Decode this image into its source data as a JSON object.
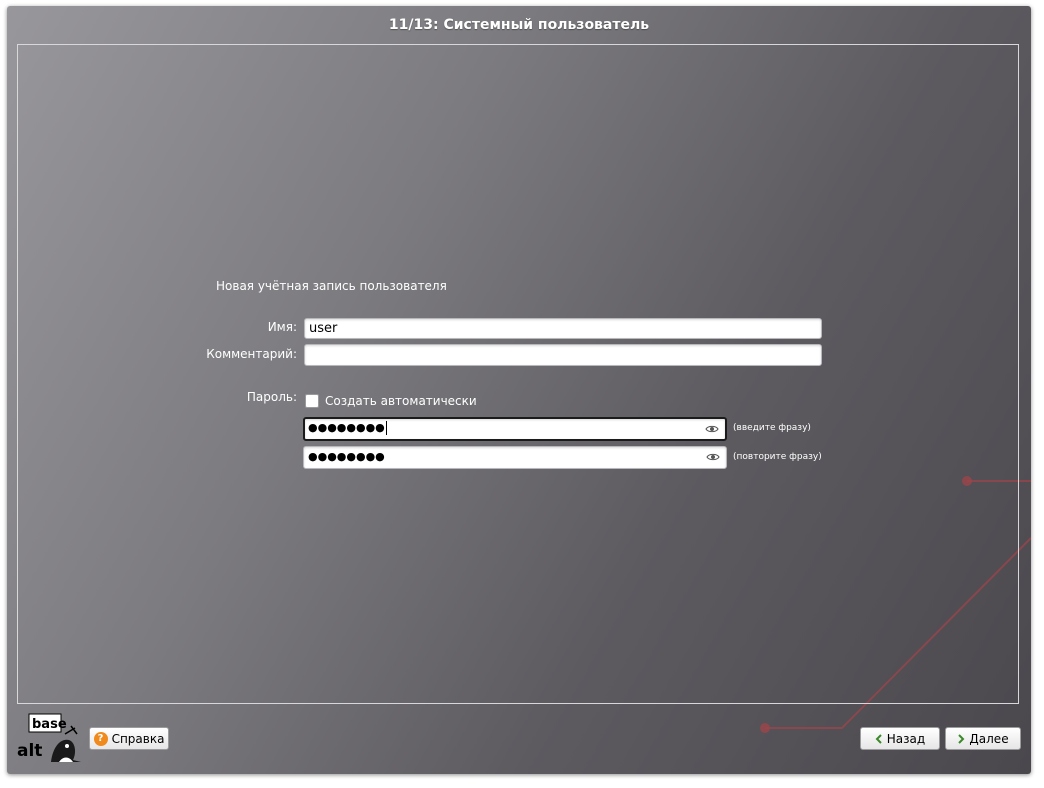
{
  "window": {
    "title": "11/13: Системный пользователь"
  },
  "form": {
    "section_title": "Новая учётная запись пользователя",
    "name_label": "Имя:",
    "name_value": "user",
    "comment_label": "Комментарий:",
    "comment_value": "",
    "password_label": "Пароль:",
    "auto_generate_label": "Создать автоматически",
    "auto_generate_checked": false,
    "password_value": "●●●●●●●●",
    "password_repeat_value": "●●●●●●●●",
    "password_hint": "(введите фразу)",
    "password_repeat_hint": "(повторите фразу)"
  },
  "footer": {
    "logo_text_top": "base",
    "logo_text_bottom": "alt",
    "help_label": "Справка",
    "back_label": "Назад",
    "next_label": "Далее"
  },
  "icons": {
    "help": "question-circle-icon",
    "show_password": "eye-icon",
    "back": "chevron-left-icon",
    "next": "chevron-right-icon"
  },
  "colors": {
    "accent_line": "#a0444a",
    "help_icon": "#f08a1c",
    "arrow_green": "#3a8a2a"
  }
}
